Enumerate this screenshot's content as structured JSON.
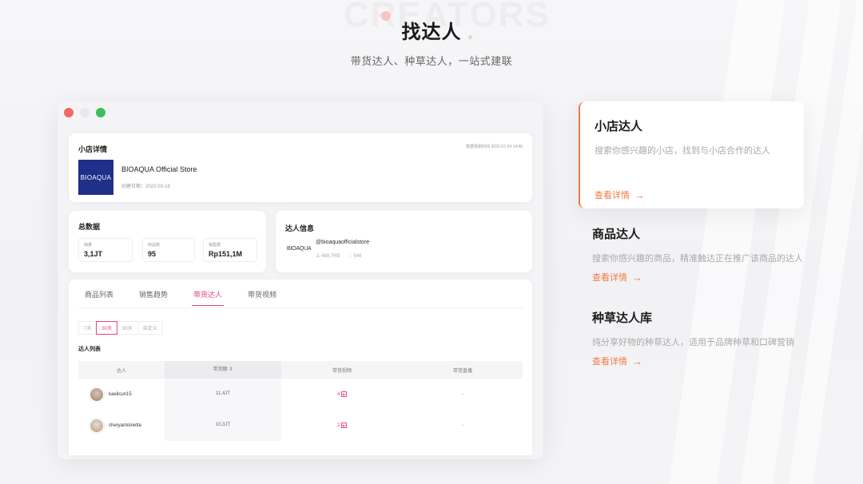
{
  "hero": {
    "title": "找达人",
    "subtitle": "带货达人、种草达人，一站式建联",
    "bg_word": "CREATORS"
  },
  "window": {
    "traffic_colors": [
      "#ee6a5f",
      "#eeeeee",
      "#3fbf5a"
    ]
  },
  "shop": {
    "section_title": "小店详情",
    "updated_text": "数据更新时间 2022-07-24 14:45",
    "logo_text": "BIOAQUA",
    "name": "BIOAQUA Official Store",
    "reg_text": "创建日期：2022-03-18"
  },
  "stats": {
    "section_title": "总数据",
    "items": [
      {
        "label": "销量",
        "value": "3,1JT"
      },
      {
        "label": "商品数",
        "value": "95"
      },
      {
        "label": "销售额",
        "value": "Rp151,1M"
      }
    ]
  },
  "kol_info": {
    "section_title": "达人信息",
    "logo_text": "BIOAQUA",
    "handle": "@bioaquaofficialstore",
    "followers": "469,7RB",
    "likes": "546"
  },
  "tabs": [
    {
      "label": "商品列表",
      "active": false
    },
    {
      "label": "销售趋势",
      "active": false
    },
    {
      "label": "带货达人",
      "active": true
    },
    {
      "label": "带货视频",
      "active": false
    }
  ],
  "ranges": [
    {
      "label": "7天",
      "active": false
    },
    {
      "label": "30天",
      "active": true
    },
    {
      "label": "90天",
      "active": false
    },
    {
      "label": "自定义",
      "active": false
    }
  ],
  "list_title": "达人列表",
  "table": {
    "headers": [
      "达人",
      "带货额 ⇕",
      "带货视频",
      "带货直播"
    ],
    "rows": [
      {
        "name": "kaeilcun15",
        "sales": "11,4JT",
        "videos": "4",
        "lives": "-"
      },
      {
        "name": "cheryantoinette",
        "sales": "10,3JT",
        "videos": "2",
        "lives": "-"
      }
    ]
  },
  "features": [
    {
      "title": "小店达人",
      "desc": "搜索你感兴趣的小店，找到与小店合作的达人",
      "link": "查看详情"
    },
    {
      "title": "商品达人",
      "desc": "搜索你感兴趣的商品，精准触达正在推广该商品的达人",
      "link": "查看详情"
    },
    {
      "title": "种草达人库",
      "desc": "纯分享好物的种草达人，适用于品牌种草和口碑营销",
      "link": "查看详情"
    }
  ],
  "colors": {
    "accent": "#f07a44",
    "pink": "#e8437a"
  }
}
